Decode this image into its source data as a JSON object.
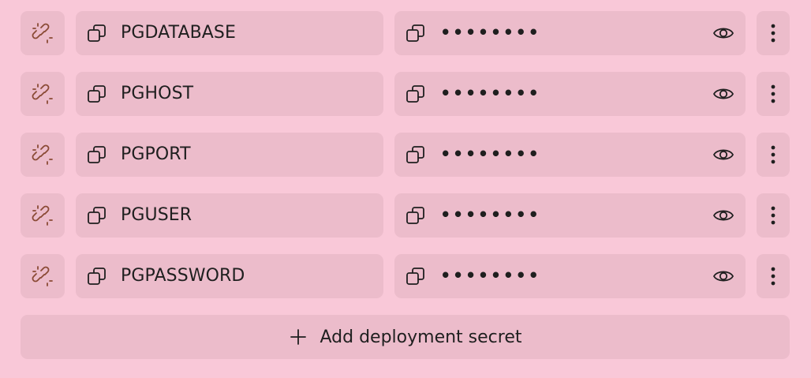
{
  "colors": {
    "background": "#f9c8d8",
    "cell": "#ecbccb",
    "text": "#1f1f1f",
    "link_icon": "#8a4a35"
  },
  "secrets": [
    {
      "key": "PGDATABASE",
      "value_masked": "••••••••",
      "link_icon": "unlink-icon",
      "copy_icon": "copy-icon",
      "visibility_icon": "eye-icon",
      "menu_icon": "more-vertical-icon"
    },
    {
      "key": "PGHOST",
      "value_masked": "••••••••",
      "link_icon": "unlink-icon",
      "copy_icon": "copy-icon",
      "visibility_icon": "eye-icon",
      "menu_icon": "more-vertical-icon"
    },
    {
      "key": "PGPORT",
      "value_masked": "••••••••",
      "link_icon": "unlink-icon",
      "copy_icon": "copy-icon",
      "visibility_icon": "eye-icon",
      "menu_icon": "more-vertical-icon"
    },
    {
      "key": "PGUSER",
      "value_masked": "••••••••",
      "link_icon": "unlink-icon",
      "copy_icon": "copy-icon",
      "visibility_icon": "eye-icon",
      "menu_icon": "more-vertical-icon"
    },
    {
      "key": "PGPASSWORD",
      "value_masked": "••••••••",
      "link_icon": "unlink-icon",
      "copy_icon": "copy-icon",
      "visibility_icon": "eye-icon",
      "menu_icon": "more-vertical-icon"
    }
  ],
  "add_button": {
    "label": "Add deployment secret",
    "icon": "plus-icon"
  }
}
